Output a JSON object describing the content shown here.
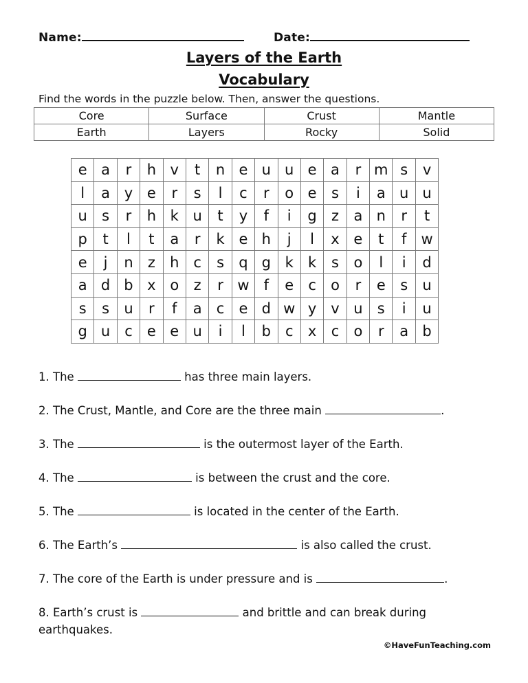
{
  "header": {
    "name_label": "Name:",
    "date_label": "Date:"
  },
  "title": "Layers of the Earth",
  "subtitle": "Vocabulary",
  "instructions": "Find the words in the puzzle below. Then, answer the questions.",
  "word_bank": [
    [
      "Core",
      "Surface",
      "Crust",
      "Mantle"
    ],
    [
      "Earth",
      "Layers",
      "Rocky",
      "Solid"
    ]
  ],
  "puzzle": [
    [
      "e",
      "a",
      "r",
      "h",
      "v",
      "t",
      "n",
      "e",
      "u",
      "u",
      "e",
      "a",
      "r",
      "m",
      "s",
      "v"
    ],
    [
      "l",
      "a",
      "y",
      "e",
      "r",
      "s",
      "l",
      "c",
      "r",
      "o",
      "e",
      "s",
      "i",
      "a",
      "u",
      "u"
    ],
    [
      "u",
      "s",
      "r",
      "h",
      "k",
      "u",
      "t",
      "y",
      "f",
      "i",
      "g",
      "z",
      "a",
      "n",
      "r",
      "t"
    ],
    [
      "p",
      "t",
      "l",
      "t",
      "a",
      "r",
      "k",
      "e",
      "h",
      "j",
      "l",
      "x",
      "e",
      "t",
      "f",
      "w"
    ],
    [
      "e",
      "j",
      "n",
      "z",
      "h",
      "c",
      "s",
      "q",
      "g",
      "k",
      "k",
      "s",
      "o",
      "l",
      "i",
      "d"
    ],
    [
      "a",
      "d",
      "b",
      "x",
      "o",
      "z",
      "r",
      "w",
      "f",
      "e",
      "c",
      "o",
      "r",
      "e",
      "s",
      "u"
    ],
    [
      "s",
      "s",
      "u",
      "r",
      "f",
      "a",
      "c",
      "e",
      "d",
      "w",
      "y",
      "v",
      "u",
      "s",
      "i",
      "u"
    ],
    [
      "g",
      "u",
      "c",
      "e",
      "e",
      "u",
      "i",
      "l",
      "b",
      "c",
      "x",
      "c",
      "o",
      "r",
      "a",
      "b"
    ]
  ],
  "questions": [
    {
      "before": "1. The ",
      "after": " has three main layers."
    },
    {
      "before": "2. The Crust, Mantle, and Core are the three main ",
      "after": "."
    },
    {
      "before": "3. The ",
      "after": " is the outermost layer of the Earth."
    },
    {
      "before": "4. The ",
      "after": " is between the crust and the core."
    },
    {
      "before": "5. The ",
      "after": " is located in the center of the Earth."
    },
    {
      "before": "6. The Earth’s ",
      "after": " is also called the crust."
    },
    {
      "before": "7. The core of the Earth is under pressure and is ",
      "after": "."
    },
    {
      "before": "8. Earth’s crust is ",
      "after": " and brittle and can break during earthquakes."
    }
  ],
  "copyright": "©HaveFunTeaching.com"
}
